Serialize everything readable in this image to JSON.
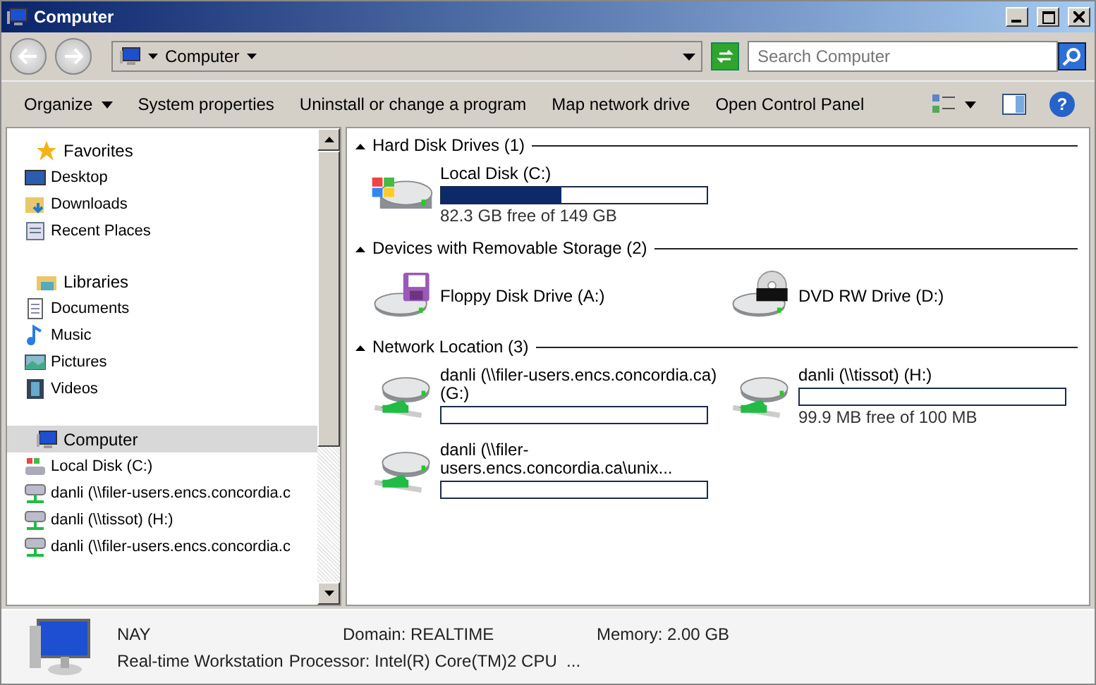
{
  "window": {
    "title": "Computer"
  },
  "address_bar": {
    "location": "Computer"
  },
  "search": {
    "placeholder": "Search Computer"
  },
  "command_bar": [
    {
      "label": "Organize",
      "dropdown": true
    },
    {
      "label": "System properties",
      "dropdown": false
    },
    {
      "label": "Uninstall or change a program",
      "dropdown": false
    },
    {
      "label": "Map network drive",
      "dropdown": false
    },
    {
      "label": "Open Control Panel",
      "dropdown": false
    }
  ],
  "sidebar": {
    "items": [
      {
        "label": "Favorites",
        "kind": "star",
        "selected": false,
        "children": [
          {
            "label": "Desktop",
            "kind": "desktop",
            "selected": false
          },
          {
            "label": "Downloads",
            "kind": "downloads",
            "selected": false
          },
          {
            "label": "Recent Places",
            "kind": "recent",
            "selected": false
          }
        ]
      },
      {
        "label": "Libraries",
        "kind": "library",
        "selected": false,
        "children": [
          {
            "label": "Documents",
            "kind": "document",
            "selected": false
          },
          {
            "label": "Music",
            "kind": "music",
            "selected": false
          },
          {
            "label": "Pictures",
            "kind": "picture",
            "selected": false
          },
          {
            "label": "Videos",
            "kind": "video",
            "selected": false
          }
        ]
      },
      {
        "label": "Computer",
        "kind": "computer",
        "selected": true,
        "children": [
          {
            "label": "Local Disk (C:)",
            "kind": "disk",
            "selected": false
          },
          {
            "label": "danli (\\\\filer-users.encs.concordia.c",
            "kind": "network",
            "selected": false
          },
          {
            "label": "danli (\\\\tissot) (H:)",
            "kind": "network",
            "selected": false
          },
          {
            "label": "danli (\\\\filer-users.encs.concordia.c",
            "kind": "network",
            "selected": false
          }
        ]
      }
    ]
  },
  "groups": [
    {
      "title": "Hard Disk Drives (1)",
      "expanded": true,
      "drives": [
        {
          "name": "Local Disk (C:)",
          "kind": "hard",
          "level": 0.45,
          "free": "82.3 GB free of 149 GB"
        }
      ]
    },
    {
      "title": "Devices with Removable Storage (2)",
      "expanded": true,
      "drives": [
        {
          "name": "Floppy Disk Drive (A:)",
          "kind": "floppy"
        },
        {
          "name": "DVD RW Drive (D:)",
          "kind": "dvd"
        }
      ]
    },
    {
      "title": "Network Location (3)",
      "expanded": true,
      "drives": [
        {
          "name": "danli (\\\\filer-users.encs.concordia.ca) (G:)",
          "kind": "network",
          "level": 0
        },
        {
          "name": "danli (\\\\tissot) (H:)",
          "kind": "network",
          "level": 0,
          "free": "99.9 MB free of 100 MB"
        },
        {
          "name": "danli (\\\\filer-users.encs.concordia.ca\\unix...",
          "kind": "network",
          "level": 0
        }
      ]
    }
  ],
  "help_button": {
    "label": "?"
  },
  "details": {
    "name": "NAY",
    "domain": "Domain: REALTIME",
    "memory": "Memory: 2.00 GB",
    "description": "Real-time Workstation",
    "processor": "Processor: Intel(R) Core(TM)2 CPU  ..."
  }
}
